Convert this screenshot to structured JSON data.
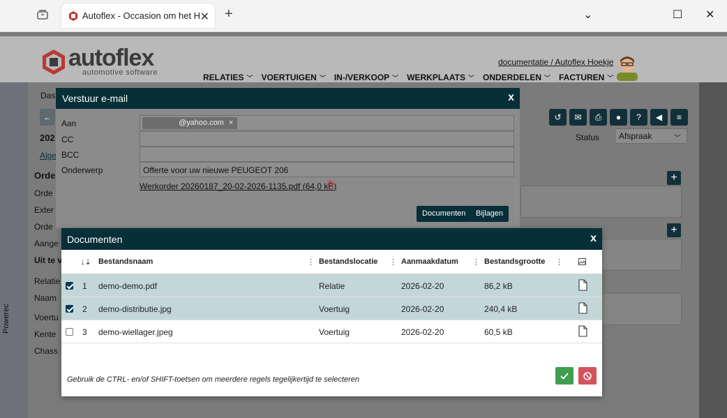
{
  "browser": {
    "tab_title": "Autoflex - Occasion om het Hoekje",
    "tab_close": "✕",
    "new_tab": "+",
    "minimize": "⌄",
    "maximize": "☐",
    "close": "✕"
  },
  "header": {
    "brand": "autoflex",
    "tagline": "automotive software",
    "user_link": "documentatie / Autoflex Hoekje",
    "nav": [
      {
        "label": "RELATIES"
      },
      {
        "label": "VOERTUIGEN"
      },
      {
        "label": "IN-/VERKOOP"
      },
      {
        "label": "WERKPLAATS"
      },
      {
        "label": "ONDERDELEN"
      },
      {
        "label": "FACTUREN"
      }
    ]
  },
  "background_page": {
    "breadcrumb": "Das",
    "number": "202",
    "tab": "Alge",
    "section_title": "Orde",
    "labels": [
      "Orde",
      "Exter",
      "Orde",
      "Aange",
      "Uit te v",
      "Relatie",
      "Naam",
      "Voertu",
      "Kente",
      "Chass"
    ],
    "status_label": "Status",
    "status_value": "Afspraak",
    "side_text": "Powerec"
  },
  "email_dialog": {
    "title": "Verstuur e-mail",
    "close": "x",
    "to_label": "Aan",
    "cc_label": "CC",
    "bcc_label": "BCC",
    "subject_label": "Onderwerp",
    "to_chip": "@yahoo.com",
    "chip_remove": "×",
    "subject_value": "Offerte voor uw nieuwe PEUGEOT 206",
    "attachment": "Werkorder 20260187_20-02-2026-1135.pdf (64,0 kB)",
    "documents_button": "Documenten",
    "attachments_button": "Bijlagen"
  },
  "documents_dialog": {
    "title": "Documenten",
    "close": "x",
    "columns": {
      "sort": "↓⇣",
      "name": "Bestandsnaam",
      "location": "Bestandslocatie",
      "created": "Aanmaakdatum",
      "size": "Bestandsgrootte"
    },
    "rows": [
      {
        "index": "1",
        "name": "demo-demo.pdf",
        "location": "Relatie",
        "created": "2026-02-20",
        "size": "86,2 kB",
        "selected": true
      },
      {
        "index": "2",
        "name": "demo-distributie.jpg",
        "location": "Voertuig",
        "created": "2026-02-20",
        "size": "240,4 kB",
        "selected": true
      },
      {
        "index": "3",
        "name": "demo-wiellager.jpeg",
        "location": "Voertuig",
        "created": "2026-02-20",
        "size": "60,5 kB",
        "selected": false
      }
    ],
    "hint": "Gebruik de CTRL- en/of SHIFT-toetsen om meerdere regels tegelijkertijd te selecteren"
  },
  "colors": {
    "dialog_header": "#062f38",
    "selected_row": "#c3d7d8",
    "ok": "#3f9f4f",
    "cancel": "#d7525a"
  }
}
